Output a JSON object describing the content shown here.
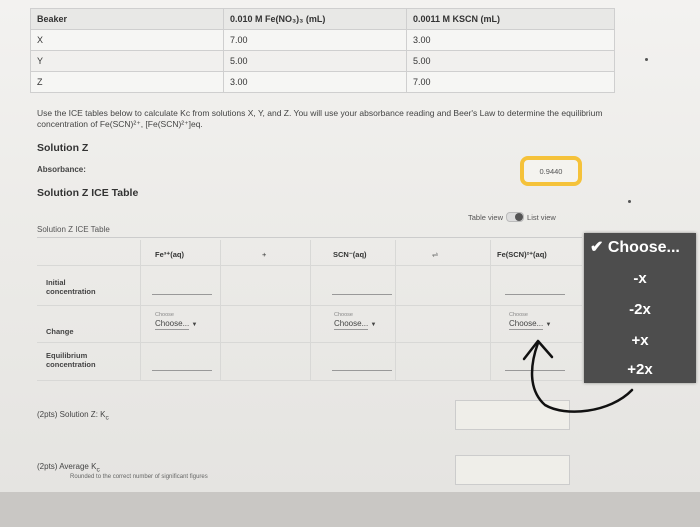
{
  "top_table": {
    "headers": [
      "Beaker",
      "0.010 M Fe(NO₃)₃ (mL)",
      "0.0011 M KSCN (mL)"
    ],
    "rows": [
      [
        "X",
        "7.00",
        "3.00"
      ],
      [
        "Y",
        "5.00",
        "5.00"
      ],
      [
        "Z",
        "3.00",
        "7.00"
      ]
    ]
  },
  "instructions": "Use the ICE tables below to calculate Kc from solutions X, Y, and Z. You will use your absorbance reading and Beer's Law to determine the equilibrium concentration of Fe(SCN)²⁺, [Fe(SCN)²⁺]eq.",
  "solution_title": "Solution Z",
  "absorbance": {
    "label": "Absorbance:",
    "value": "0.9440"
  },
  "ice_table_title": "Solution Z ICE Table",
  "view_toggle": {
    "table_view": "Table view",
    "list_view": "List view"
  },
  "ice": {
    "caption": "Solution Z ICE Table",
    "columns": [
      "Fe³⁺(aq)",
      "+",
      "SCN⁻(aq)",
      "⇌",
      "Fe(SCN)²⁺(aq)"
    ],
    "rows": [
      "Initial concentration",
      "Change",
      "Equilibrium concentration"
    ],
    "choose_small": "Choose",
    "choose_label": "Choose..."
  },
  "question1": "(2pts)  Solution Z: K",
  "question1_sub": "c",
  "question2": "(2pts)  Average K",
  "question2_sub": "c",
  "question2_note": "Rounded to the correct number of significant figures",
  "dropdown": {
    "options": [
      "✔ Choose...",
      "-x",
      "-2x",
      "+x",
      "+2x"
    ]
  }
}
